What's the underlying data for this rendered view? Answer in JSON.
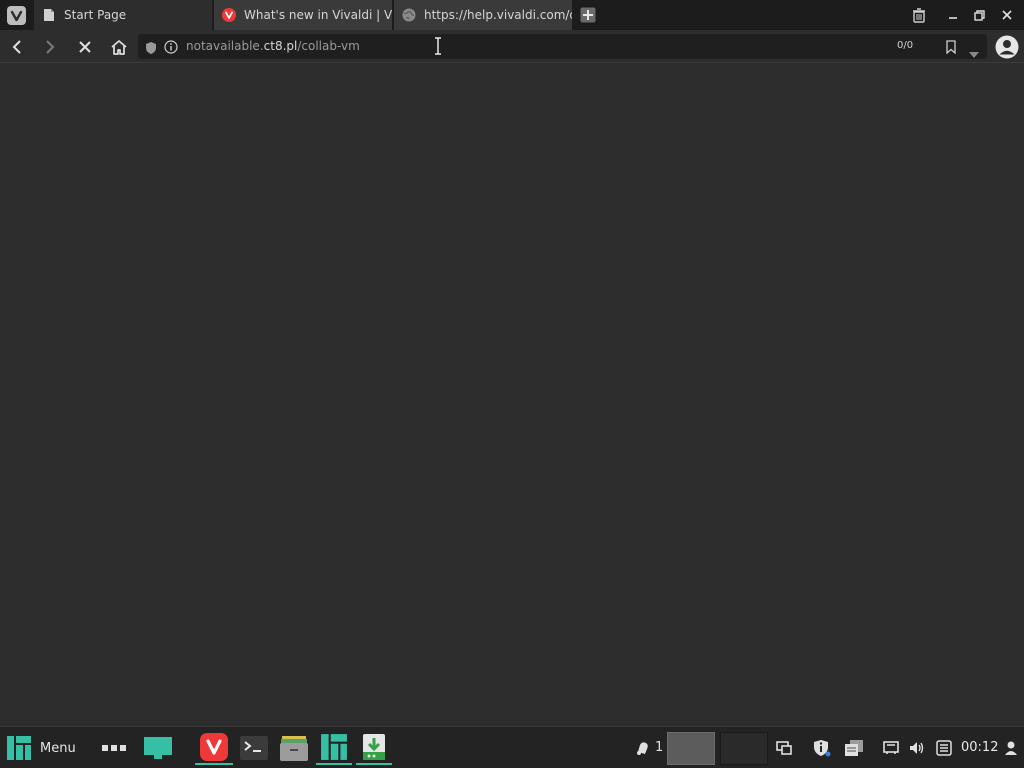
{
  "tabs": [
    {
      "title": "Start Page",
      "icon": "page-icon"
    },
    {
      "title": "What's new in Vivaldi | Viva",
      "icon": "vivaldi-icon"
    },
    {
      "title": "https://help.vivaldi.com/de",
      "icon": "globe-icon"
    }
  ],
  "address": {
    "host": "notavailable.ct8.pl",
    "path": "/collab-vm",
    "prefix": "notavailable.",
    "domain": "ct8.pl"
  },
  "toolbar": {
    "counter": "0/0"
  },
  "taskbar": {
    "menu_label": "Menu",
    "notification_count": "1",
    "clock": "00:12"
  },
  "colors": {
    "accent": "#35bfa4",
    "vivaldi_red": "#ef3939",
    "background": "#2d2d2d"
  }
}
